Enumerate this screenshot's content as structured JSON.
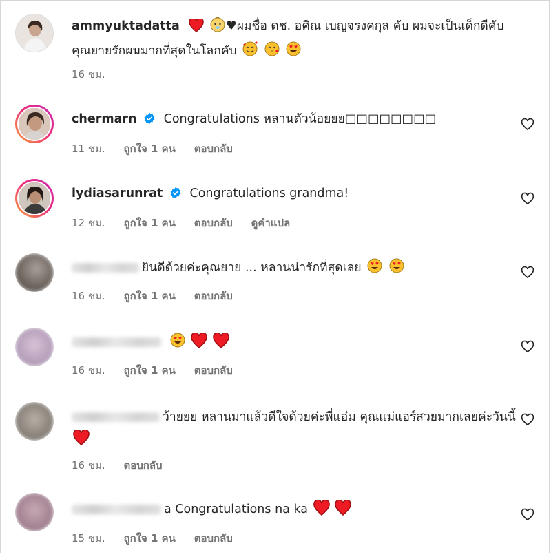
{
  "comments": [
    {
      "username": "ammyuktadatta",
      "text_parts": [
        "",
        "♥ผมชื่อ ดช. อคิณ เบญจรงคกุล คับ ผมจะเป็นเด็กดีคับ คุณยายรักผมมากที่สุดในโลกคับ"
      ],
      "time": "16 ชม.",
      "likes": "",
      "reply": "",
      "translate": ""
    },
    {
      "username": "chermarn",
      "text": "Congratulations หลานตัวน้อยยย□□□□□□□□",
      "time": "11 ชม.",
      "likes": "ถูกใจ 1 คน",
      "reply": "ตอบกลับ"
    },
    {
      "username": "lydiasarunrat",
      "text": "Congratulations grandma!",
      "time": "12 ชม.",
      "likes": "ถูกใจ 1 คน",
      "reply": "ตอบกลับ",
      "translate": "ดูคำแปล"
    },
    {
      "text": "ยินดีด้วยค่ะคุณยาย ... หลานน่ารักที่สุดเลย",
      "time": "16 ชม.",
      "likes": "ถูกใจ 1 คน",
      "reply": "ตอบกลับ"
    },
    {
      "text": "",
      "time": "16 ชม.",
      "likes": "ถูกใจ 1 คน",
      "reply": "ตอบกลับ"
    },
    {
      "text": "ว้ายยย หลานมาแล้วดีใจด้วยค่ะพี่แอ๋ม คุณแม่แอร์สวยมากเลยค่ะวันนี้",
      "time": "16 ชม.",
      "likes": "",
      "reply": "ตอบกลับ"
    },
    {
      "text": "a Congratulations na ka",
      "time": "15 ชม.",
      "likes": "ถูกใจ 1 คน",
      "reply": "ตอบกลับ"
    }
  ],
  "colors": {
    "text": "#262626",
    "meta": "#737373",
    "verified": "#0095f6",
    "heart_red": "#ed1c24"
  }
}
